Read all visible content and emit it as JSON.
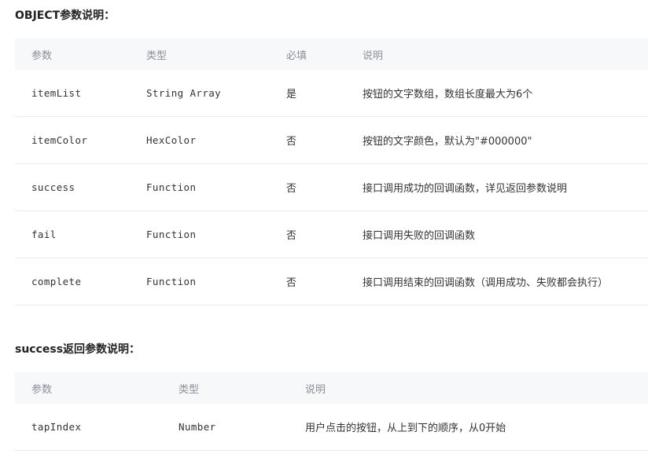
{
  "object_section": {
    "title": "OBJECT参数说明：",
    "headers": [
      "参数",
      "类型",
      "必填",
      "说明"
    ],
    "rows": [
      {
        "param": "itemList",
        "type": "String Array",
        "required": "是",
        "desc": "按钮的文字数组，数组长度最大为6个"
      },
      {
        "param": "itemColor",
        "type": "HexColor",
        "required": "否",
        "desc": "按钮的文字颜色，默认为\"#000000\""
      },
      {
        "param": "success",
        "type": "Function",
        "required": "否",
        "desc": "接口调用成功的回调函数，详见返回参数说明"
      },
      {
        "param": "fail",
        "type": "Function",
        "required": "否",
        "desc": "接口调用失败的回调函数"
      },
      {
        "param": "complete",
        "type": "Function",
        "required": "否",
        "desc": "接口调用结束的回调函数（调用成功、失败都会执行）"
      }
    ]
  },
  "success_section": {
    "title": "success返回参数说明：",
    "headers": [
      "参数",
      "类型",
      "说明"
    ],
    "rows": [
      {
        "param": "tapIndex",
        "type": "Number",
        "desc": "用户点击的按钮，从上到下的顺序，从0开始"
      }
    ]
  }
}
